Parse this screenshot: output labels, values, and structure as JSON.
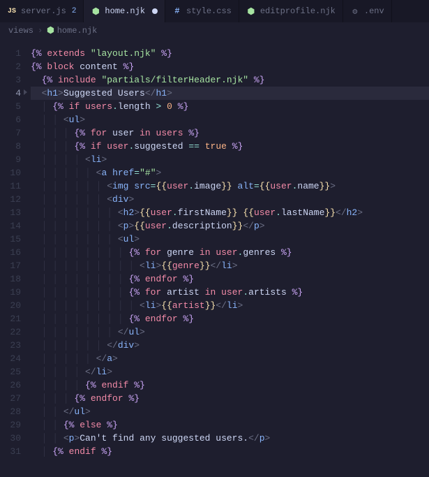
{
  "tabs": [
    {
      "label": "server.js",
      "icon": "JS",
      "iconClass": "icon-js",
      "badge": "2",
      "active": false,
      "modified": false
    },
    {
      "label": "home.njk",
      "icon": "⬢",
      "iconClass": "icon-njk",
      "badge": "",
      "active": true,
      "modified": true
    },
    {
      "label": "style.css",
      "icon": "#",
      "iconClass": "icon-css",
      "badge": "",
      "active": false,
      "modified": false
    },
    {
      "label": "editprofile.njk",
      "icon": "⬢",
      "iconClass": "icon-njk",
      "badge": "",
      "active": false,
      "modified": false
    },
    {
      "label": ".env",
      "icon": "⚙",
      "iconClass": "icon-env",
      "badge": "",
      "active": false,
      "modified": false
    }
  ],
  "breadcrumbs": {
    "crumb1": "views",
    "crumb2": "home.njk",
    "crumb2icon": "⬢"
  },
  "totalLines": 31,
  "activeLine": 4,
  "code": {
    "l1": {
      "kw1": "extends",
      "str1": "\"layout.njk\""
    },
    "l2": {
      "kw1": "block",
      "kw2": "content"
    },
    "l3": {
      "kw1": "include",
      "str1": "\"partials/filterHeader.njk\""
    },
    "l4": {
      "tag": "h1",
      "text": "Suggested Users"
    },
    "l5": {
      "kw1": "if",
      "var1": "users",
      "prop1": "length",
      "op": ">",
      "num": "0"
    },
    "l6": {
      "tag": "ul"
    },
    "l7": {
      "kw1": "for",
      "var1": "user",
      "kw2": "in",
      "var2": "users"
    },
    "l8": {
      "kw1": "if",
      "var1": "user",
      "prop1": "suggested",
      "op": "==",
      "bool": "true"
    },
    "l9": {
      "tag": "li"
    },
    "l10": {
      "tag": "a",
      "attr": "href",
      "val": "\"#\""
    },
    "l11": {
      "tag": "img",
      "attr1": "src",
      "var1": "user",
      "prop1": "image",
      "attr2": "alt",
      "var2": "user",
      "prop2": "name"
    },
    "l12": {
      "tag": "div"
    },
    "l13": {
      "tag": "h2",
      "var1": "user",
      "prop1": "firstName",
      "var2": "user",
      "prop2": "lastName"
    },
    "l14": {
      "tag": "p",
      "var1": "user",
      "prop1": "description"
    },
    "l15": {
      "tag": "ul"
    },
    "l16": {
      "kw1": "for",
      "var1": "genre",
      "kw2": "in",
      "var2": "user",
      "prop2": "genres"
    },
    "l17": {
      "tag": "li",
      "var1": "genre"
    },
    "l18": {
      "kw1": "endfor"
    },
    "l19": {
      "kw1": "for",
      "var1": "artist",
      "kw2": "in",
      "var2": "user",
      "prop2": "artists"
    },
    "l20": {
      "tag": "li",
      "var1": "artist"
    },
    "l21": {
      "kw1": "endfor"
    },
    "l22": {
      "tag": "ul"
    },
    "l23": {
      "tag": "div"
    },
    "l24": {
      "tag": "a"
    },
    "l25": {
      "tag": "li"
    },
    "l26": {
      "kw1": "endif"
    },
    "l27": {
      "kw1": "endfor"
    },
    "l28": {
      "tag": "ul"
    },
    "l29": {
      "kw1": "else"
    },
    "l30": {
      "tag": "p",
      "text": "Can't find any suggested users."
    },
    "l31": {
      "kw1": "endif"
    }
  }
}
